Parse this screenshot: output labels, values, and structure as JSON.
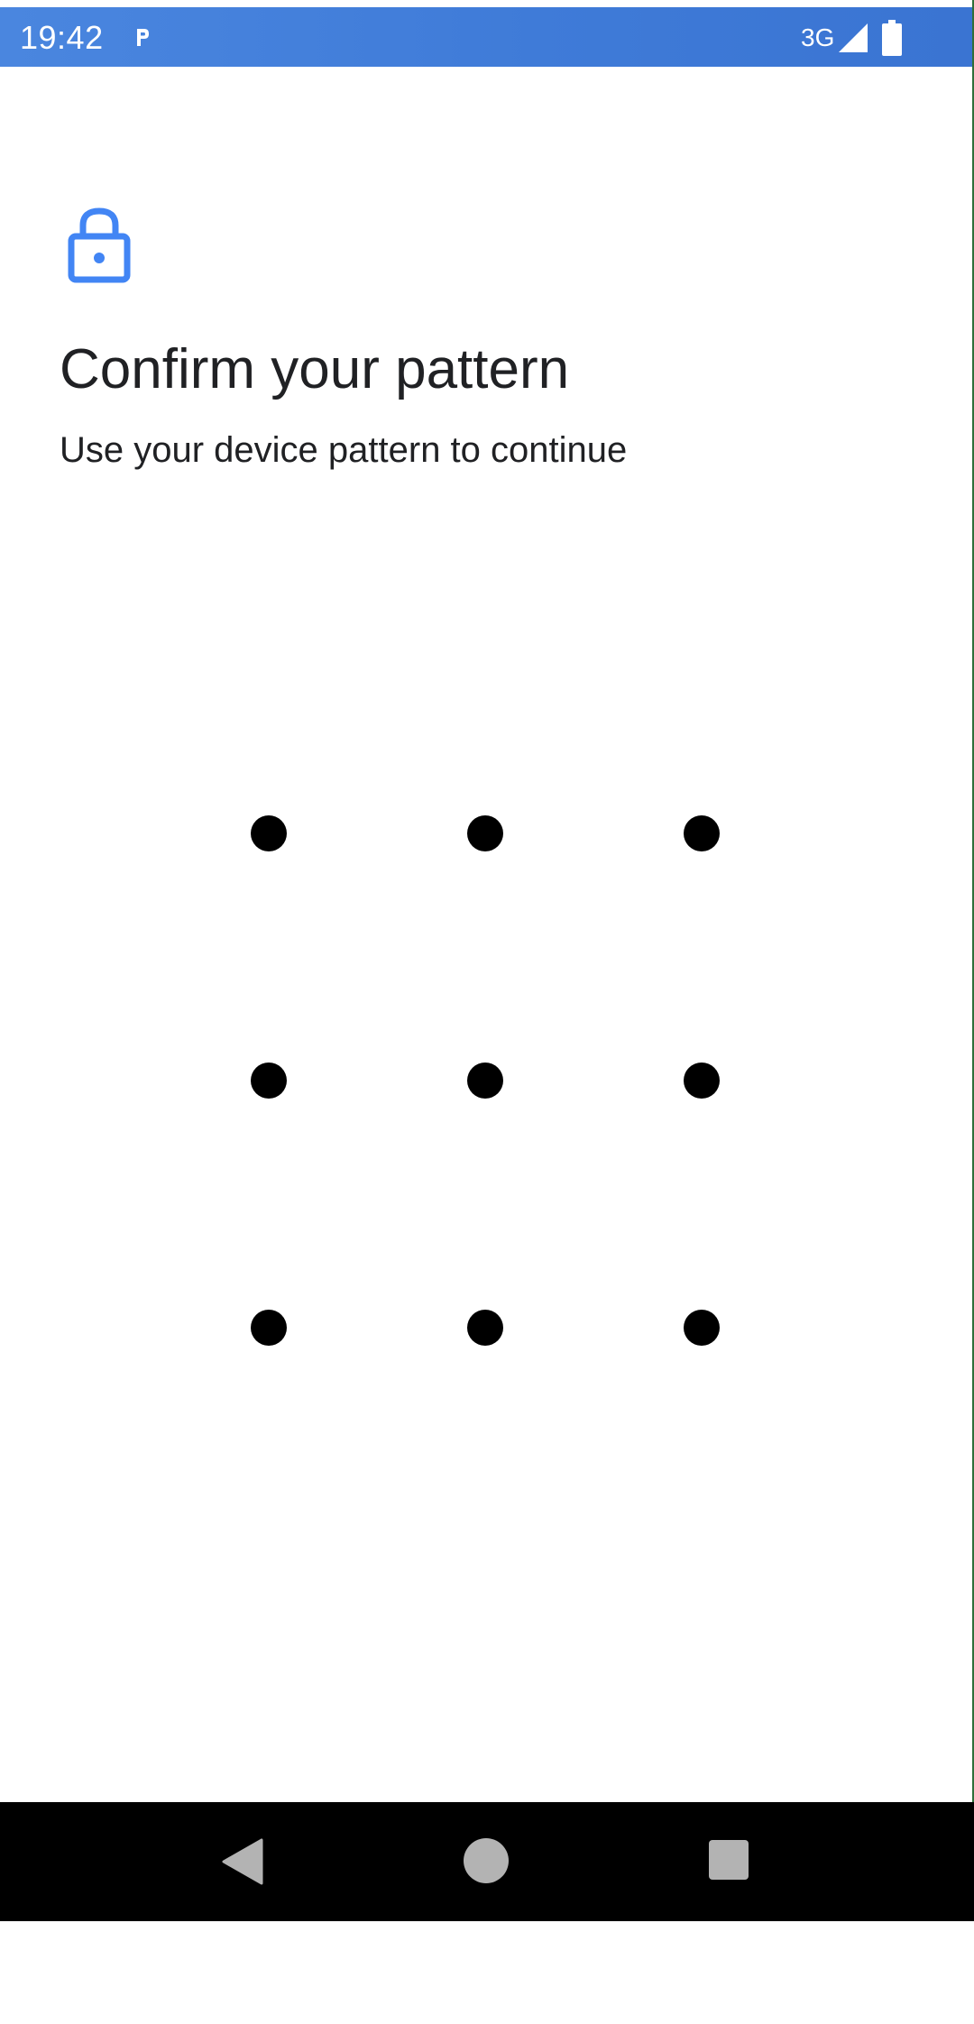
{
  "status_bar": {
    "time": "19:42",
    "network_type": "3G",
    "icons": [
      "parking-p-icon",
      "signal-icon",
      "battery-icon"
    ],
    "background_color": "#3f7bd8"
  },
  "header": {
    "icon": "lock-icon",
    "icon_color": "#4285f4",
    "title": "Confirm your pattern",
    "subtitle": "Use your device pattern to continue"
  },
  "pattern": {
    "rows": 3,
    "columns": 3,
    "dot_color": "#000000"
  },
  "nav_bar": {
    "buttons": [
      "back-button",
      "home-button",
      "recents-button"
    ]
  }
}
